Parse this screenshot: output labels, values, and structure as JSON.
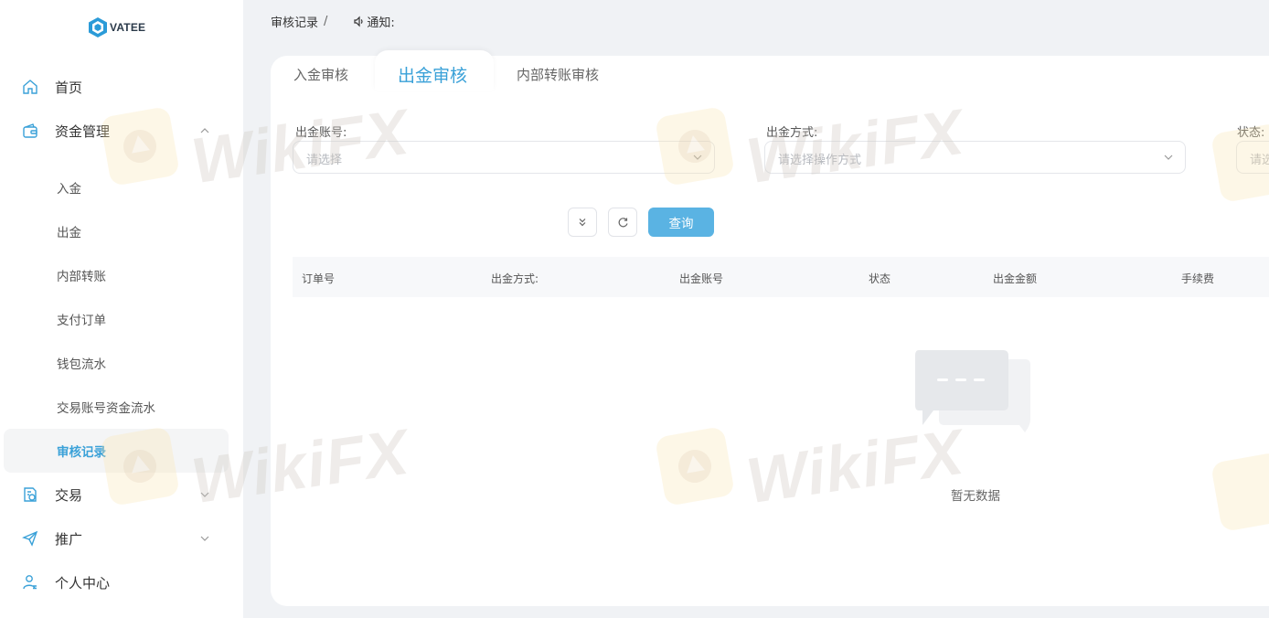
{
  "brand": {
    "logo_text": "VATEE",
    "logo_color": "#2b9bd8"
  },
  "colors": {
    "accent": "#3aa1d8",
    "button": "#5ab3e3",
    "page_bg": "#f0f2f5"
  },
  "sidebar": {
    "menu": [
      {
        "label": "首页",
        "icon": "home-icon"
      },
      {
        "label": "资金管理",
        "icon": "wallet-icon",
        "expanded": true
      },
      {
        "label": "交易",
        "icon": "trade-doc-icon",
        "expanded": false
      },
      {
        "label": "推广",
        "icon": "paper-plane-icon",
        "expanded": false
      },
      {
        "label": "个人中心",
        "icon": "user-icon"
      }
    ],
    "submenu": [
      {
        "label": "入金"
      },
      {
        "label": "出金"
      },
      {
        "label": "内部转账"
      },
      {
        "label": "支付订单"
      },
      {
        "label": "钱包流水"
      },
      {
        "label": "交易账号资金流水"
      },
      {
        "label": "审核记录",
        "active": true
      }
    ]
  },
  "topbar": {
    "breadcrumb": "审核记录",
    "separator": "/",
    "notice_label": "通知:"
  },
  "tabs": [
    {
      "label": "入金审核"
    },
    {
      "label": "出金审核",
      "active": true
    },
    {
      "label": "内部转账审核"
    }
  ],
  "filters": {
    "account": {
      "label": "出金账号:",
      "placeholder": "请选择"
    },
    "method": {
      "label": "出金方式:",
      "placeholder": "请选择操作方式"
    },
    "status": {
      "label": "状态:",
      "placeholder": "请选"
    }
  },
  "actions": {
    "query_label": "查询"
  },
  "table": {
    "columns": [
      "订单号",
      "出金方式:",
      "出金账号",
      "状态",
      "出金金额",
      "手续费"
    ],
    "rows": [],
    "empty_text": "暂无数据"
  },
  "watermark": {
    "text": "WikiFX"
  }
}
